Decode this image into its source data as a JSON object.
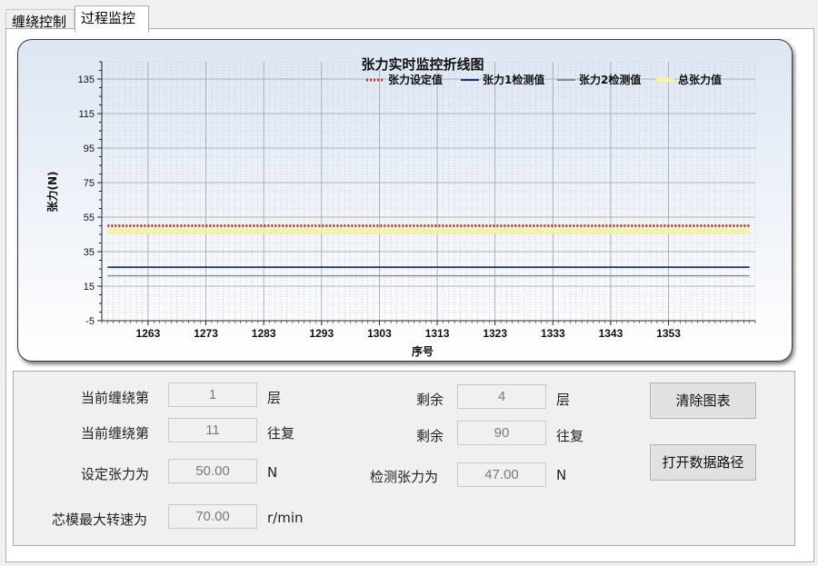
{
  "tabs": [
    {
      "label": "缠绕控制"
    },
    {
      "label": "过程监控"
    }
  ],
  "chart_data": {
    "type": "line",
    "title": "张力实时监控折线图",
    "xlabel": "序号",
    "ylabel": "张力(N)",
    "xlim": [
      1255,
      1368
    ],
    "ylim": [
      -5,
      145
    ],
    "xticks": [
      1263,
      1273,
      1283,
      1293,
      1303,
      1313,
      1323,
      1333,
      1343,
      1353
    ],
    "yticks": [
      -5,
      15,
      35,
      55,
      75,
      95,
      115,
      135
    ],
    "legend_position": "top-right",
    "grid": true,
    "series": [
      {
        "name": "张力设定值",
        "style": "dotted",
        "color": "#c0392b",
        "x": [
          1256,
          1367
        ],
        "y": [
          50,
          50
        ]
      },
      {
        "name": "张力1检测值",
        "style": "solid",
        "color": "#1f2f8f",
        "x": [
          1256,
          1367
        ],
        "y": [
          26,
          26
        ]
      },
      {
        "name": "张力2检测值",
        "style": "solid",
        "color": "#8a8a8a",
        "x": [
          1256,
          1367
        ],
        "y": [
          21,
          21
        ]
      },
      {
        "name": "总张力值",
        "style": "solid",
        "color": "#f3f3a0",
        "x": [
          1256,
          1367
        ],
        "y": [
          47,
          47
        ]
      }
    ]
  },
  "form": {
    "layer_label": "当前缠绕第",
    "layer_value": "1",
    "layer_unit": "层",
    "recip_label": "当前缠绕第",
    "recip_value": "11",
    "recip_unit": "往复",
    "remain_layer_label": "剩余",
    "remain_layer_value": "4",
    "remain_layer_unit": "层",
    "remain_recip_label": "剩余",
    "remain_recip_value": "90",
    "remain_recip_unit": "往复",
    "set_tension_label": "设定张力为",
    "set_tension_value": "50.00",
    "set_tension_unit": "N",
    "detect_tension_label": "检测张力为",
    "detect_tension_value": "47.00",
    "detect_tension_unit": "N",
    "max_speed_label": "芯模最大转速为",
    "max_speed_value": "70.00",
    "max_speed_unit": "r/min",
    "clear_chart_button": "清除图表",
    "open_path_button": "打开数据路径"
  }
}
